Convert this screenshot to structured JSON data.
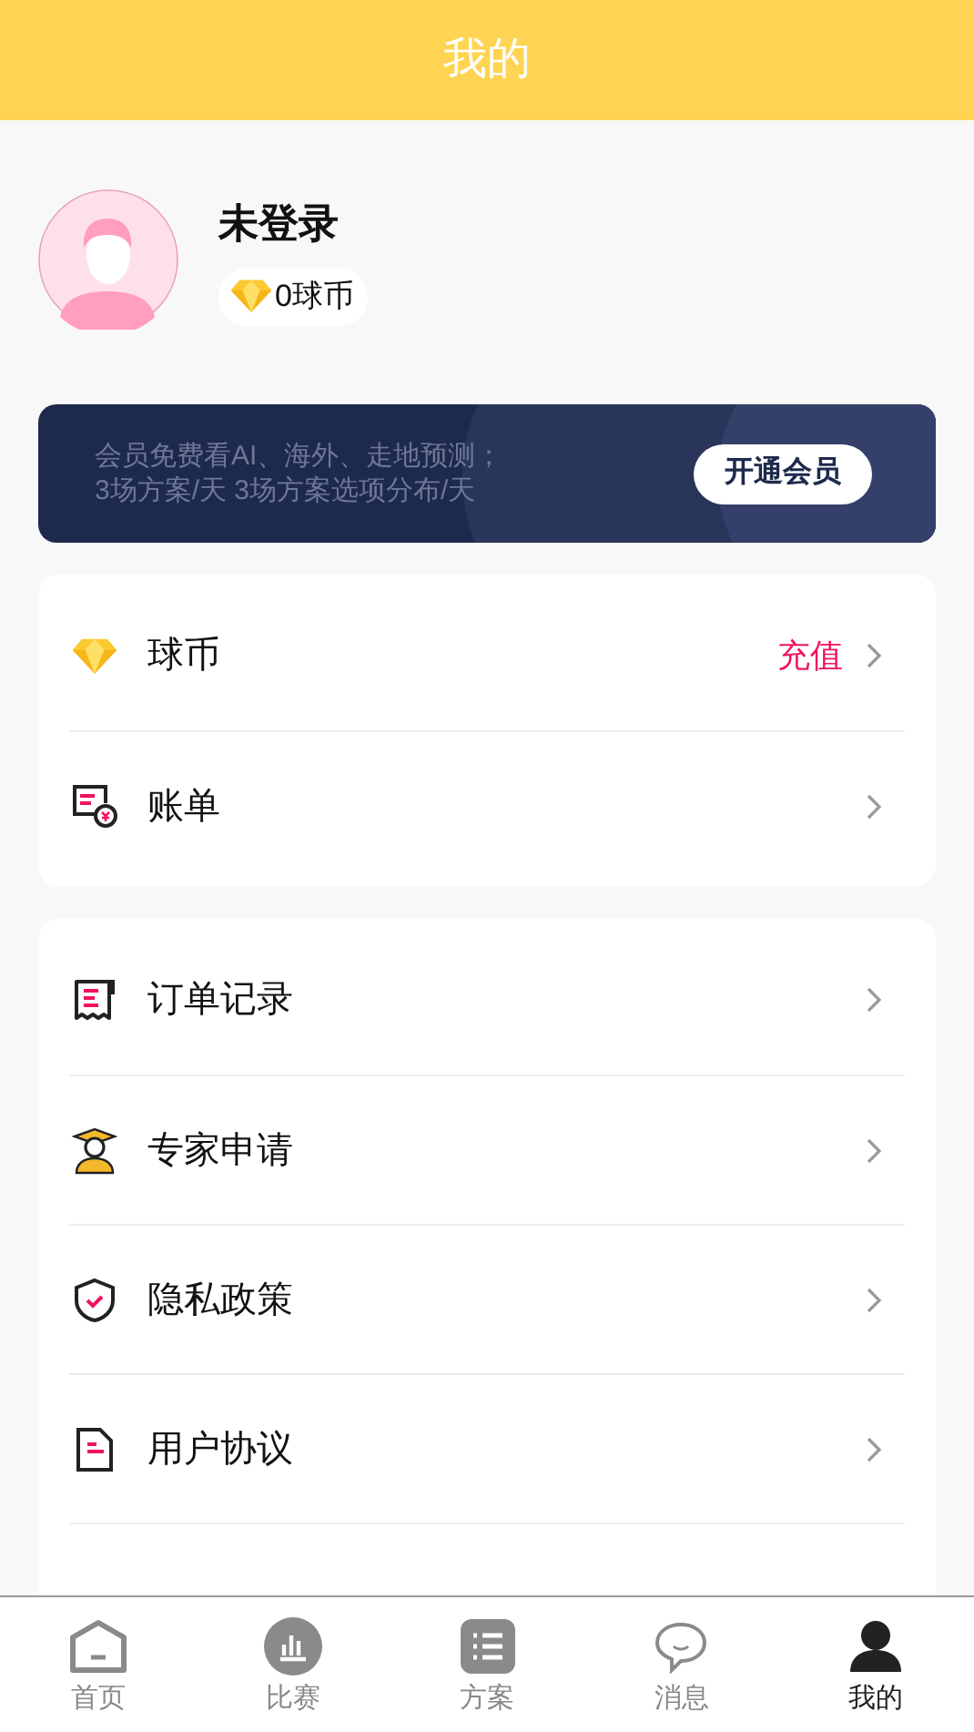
{
  "header": {
    "title": "我的"
  },
  "profile": {
    "name": "未登录",
    "coins": "0球币"
  },
  "banner": {
    "text": "会员免费看AI、海外、走地预测；\n3场方案/天 3场方案选项分布/天",
    "button": "开通会员"
  },
  "groups": [
    {
      "items": [
        {
          "kind": "coin",
          "label": "球币",
          "action": "充值"
        },
        {
          "kind": "bill",
          "label": "账单"
        }
      ]
    },
    {
      "items": [
        {
          "kind": "order",
          "label": "订单记录"
        },
        {
          "kind": "expert",
          "label": "专家申请"
        },
        {
          "kind": "privacy",
          "label": "隐私政策"
        },
        {
          "kind": "agreement",
          "label": "用户协议"
        }
      ]
    }
  ],
  "tabs": [
    {
      "kind": "home",
      "label": "首页",
      "selected": false
    },
    {
      "kind": "match",
      "label": "比赛",
      "selected": false
    },
    {
      "kind": "plan",
      "label": "方案",
      "selected": false
    },
    {
      "kind": "message",
      "label": "消息",
      "selected": false
    },
    {
      "kind": "me",
      "label": "我的",
      "selected": true
    }
  ]
}
